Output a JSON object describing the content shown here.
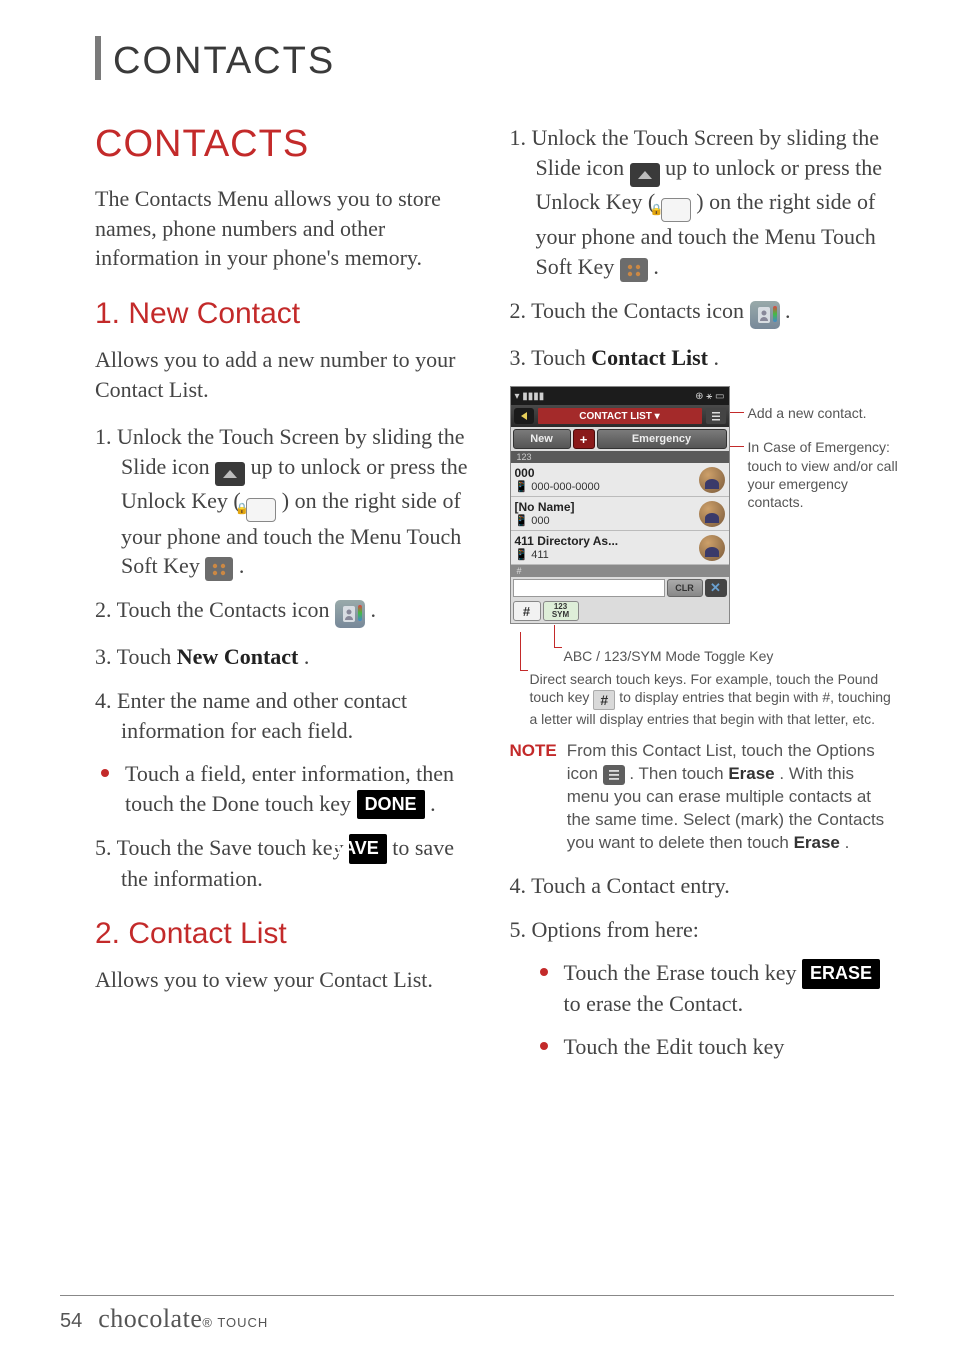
{
  "header": "CONTACTS",
  "section_title": "CONTACTS",
  "intro": "The Contacts Menu allows you to store names, phone numbers and other information in your phone's memory.",
  "sub1_title": "1. New Contact",
  "sub1_intro": "Allows you to add a new number to your Contact List.",
  "nc": {
    "s1_a": "1. Unlock the Touch Screen by sliding the Slide icon ",
    "s1_b": " up to unlock or press the Unlock Key ( ",
    "s1_c": " ) on the right side of your phone and touch the Menu Touch Soft Key ",
    "s1_d": " .",
    "s2_a": "2. Touch the Contacts icon ",
    "s2_b": " .",
    "s3_a": "3. Touch ",
    "s3_b": "New Contact",
    "s3_c": ".",
    "s4": "4. Enter the name and other contact information for each field.",
    "b1_a": "Touch a field, enter information, then touch the Done touch key ",
    "b1_b": " .",
    "s5_a": "5. Touch the Save touch key ",
    "s5_b": " to save the information."
  },
  "sub2_title": "2. Contact List",
  "sub2_intro": "Allows you to view your Contact List.",
  "cl": {
    "s1_a": "1. Unlock the Touch Screen by sliding the Slide icon ",
    "s1_b": " up to unlock or press the Unlock Key ( ",
    "s1_c": " ) on the right side of your phone and touch the Menu Touch Soft Key ",
    "s1_d": " .",
    "s2_a": "2. Touch the Contacts icon ",
    "s2_b": " .",
    "s3_a": "3. Touch ",
    "s3_b": "Contact List",
    "s3_c": ".",
    "s4": "4. Touch a Contact entry.",
    "s5": "5. Options from here:",
    "opt1_a": "Touch the Erase touch key ",
    "opt1_b": " to erase the Contact.",
    "opt2": "Touch the Edit touch key"
  },
  "labels": {
    "done": "DONE",
    "save": "SAVE",
    "erase": "ERASE"
  },
  "phone": {
    "title": "CONTACT LIST ▾",
    "new": "New",
    "emergency": "Emergency",
    "idx1": "123",
    "row1_name": "000",
    "row1_num": "000-000-0000",
    "row2_name": "[No Name]",
    "row2_num": "000",
    "row3_name": "411 Directory As...",
    "row3_num": "411",
    "idx2": "#",
    "clr": "CLR",
    "x": "✕",
    "pound": "#",
    "sym1": "123",
    "sym2": "SYM"
  },
  "callouts": {
    "add": "Add a new contact.",
    "emg": "In Case of Emergency: touch to view and/or call your emergency contacts.",
    "abc": "ABC / 123/SYM Mode Toggle Key",
    "direct_a": "Direct search touch keys. For example, touch the Pound touch key ",
    "direct_b": " to display entries that begin with #, touching a letter will display entries that begin with that letter, etc."
  },
  "note": {
    "label": "NOTE",
    "a": "From this Contact List, touch the Options icon ",
    "b": " . Then touch ",
    "erase1": "Erase",
    "c": ". With this menu you can erase multiple contacts at the same time. Select (mark) the Contacts you want to delete then touch ",
    "erase2": "Erase",
    "d": "."
  },
  "footer": {
    "page": "54",
    "brand": "chocolate",
    "brand_sub": "TOUCH"
  }
}
